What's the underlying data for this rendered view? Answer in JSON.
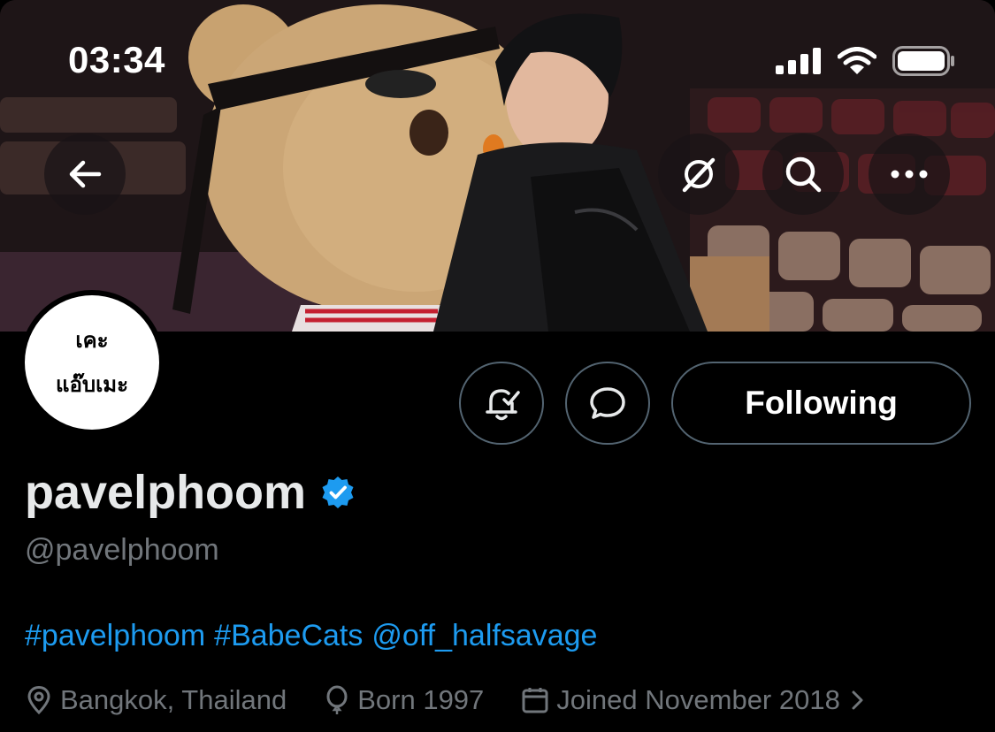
{
  "status_bar": {
    "time": "03:34",
    "icons": [
      "signal-icon",
      "wifi-icon",
      "battery-icon"
    ]
  },
  "top_bar": {
    "icons": [
      "back-arrow-icon",
      "grok-icon",
      "search-icon",
      "more-icon"
    ]
  },
  "avatar": {
    "line1": "เคะ",
    "line2": "แอ๊บเมะ"
  },
  "actions": {
    "notify_icon": "bell-check-icon",
    "message_icon": "message-bubble-icon",
    "following_label": "Following"
  },
  "profile": {
    "display_name": "pavelphoom",
    "verified_icon": "verified-badge-icon",
    "handle": "@pavelphoom",
    "bio": [
      "#pavelphoom",
      "#BabeCats",
      "@off_halfsavage"
    ],
    "location": "Bangkok, Thailand",
    "born": "Born 1997",
    "joined": "Joined November 2018"
  },
  "colors": {
    "background": "#000000",
    "link": "#1d9bf0",
    "secondary_text": "#71767b",
    "verified": "#1d9bf0",
    "border": "#536471"
  }
}
